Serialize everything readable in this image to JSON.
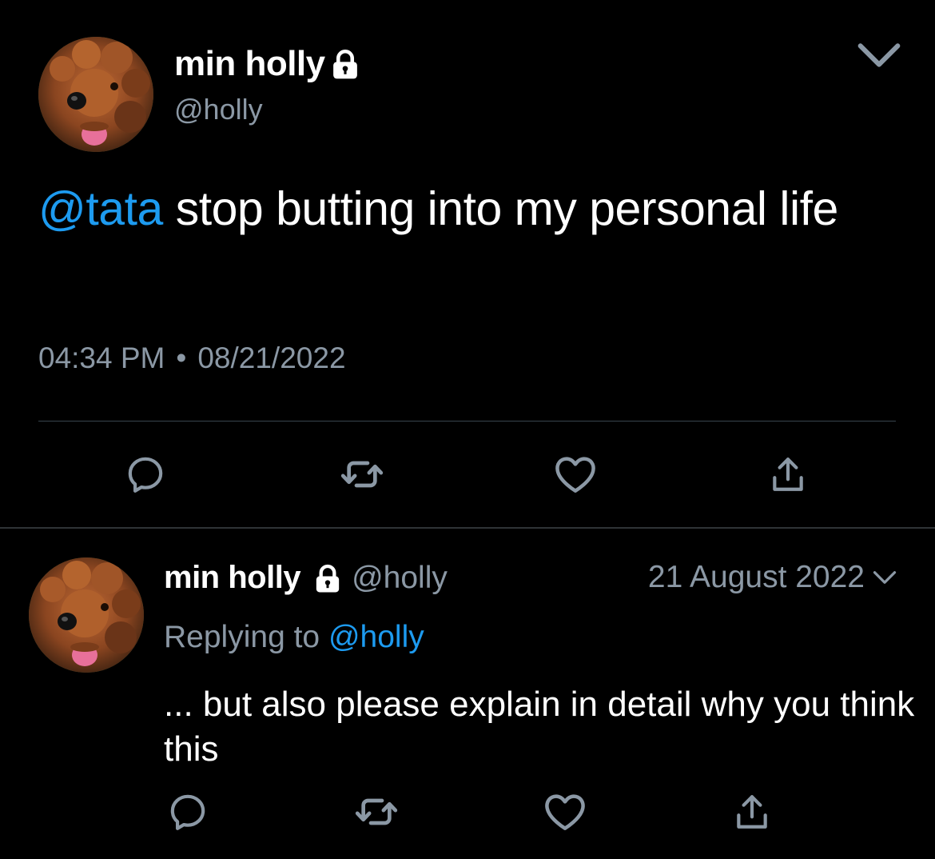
{
  "colors": {
    "background": "#000000",
    "text": "#ffffff",
    "secondary_text": "#8b98a5",
    "link": "#1d9bf0",
    "divider": "#38444d"
  },
  "tweet": {
    "author_name": "min holly",
    "author_handle": "@holly",
    "mention": "@tata",
    "body": " stop butting into my personal life",
    "time": "04:34 PM",
    "separator": "•",
    "date": "08/21/2022",
    "icons": [
      "lock-icon",
      "chevron-down-icon",
      "reply-icon",
      "retweet-icon",
      "like-icon",
      "share-icon"
    ]
  },
  "reply": {
    "author_name": "min holly",
    "author_handle": "@holly",
    "date": "21 August 2022",
    "replying_label": "Replying to ",
    "replying_to": "@holly",
    "body": "... but also please explain in detail why you think this",
    "icons": [
      "lock-icon",
      "chevron-down-icon",
      "reply-icon",
      "retweet-icon",
      "like-icon",
      "share-icon"
    ]
  }
}
